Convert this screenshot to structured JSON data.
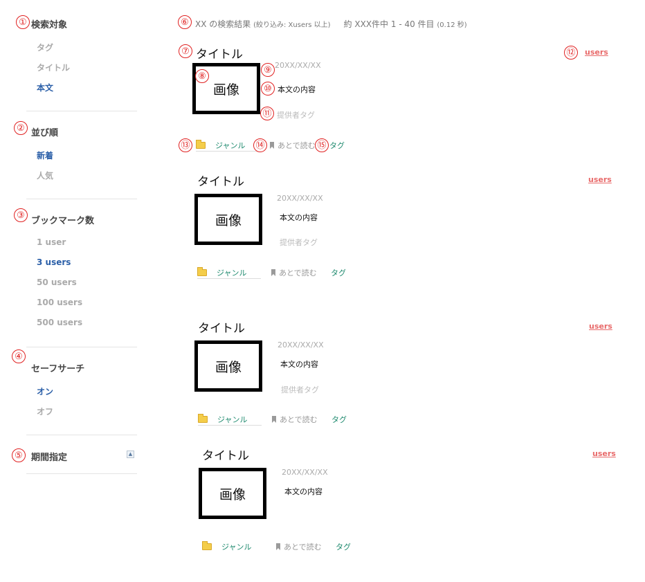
{
  "sidebar": {
    "sections": [
      {
        "heading": "検索対象",
        "items": [
          {
            "label": "タグ"
          },
          {
            "label": "タイトル"
          },
          {
            "label": "本文"
          }
        ]
      },
      {
        "heading": "並び順",
        "items": [
          {
            "label": "新着"
          },
          {
            "label": "人気"
          }
        ]
      },
      {
        "heading": "ブックマーク数",
        "items": [
          {
            "label": "1 user"
          },
          {
            "label": "3 users"
          },
          {
            "label": "50 users"
          },
          {
            "label": "100 users"
          },
          {
            "label": "500 users"
          }
        ]
      },
      {
        "heading": "セーフサーチ",
        "items": [
          {
            "label": "オン"
          },
          {
            "label": "オフ"
          }
        ]
      },
      {
        "heading": "期間指定"
      }
    ],
    "active_labels": [
      "本文",
      "新着",
      "3 users",
      "オン"
    ]
  },
  "results_header": {
    "query": "XX の検索結果",
    "filter": "(絞り込み: Xusers 以上)",
    "count": "約 XXX件中 1 - 40 件目",
    "time": "(0.12 秒)"
  },
  "entries": [
    {
      "title": "タイトル",
      "users": "users",
      "image": "画像",
      "date": "20XX/XX/XX",
      "body": "本文の内容",
      "provider_tag": "提供者タグ",
      "genre": "ジャンル",
      "read_later": "あとで読む",
      "tag": "タグ"
    },
    {
      "title": "タイトル",
      "users": "users",
      "image": "画像",
      "date": "20XX/XX/XX",
      "body": "本文の内容",
      "provider_tag": "提供者タグ",
      "genre": "ジャンル",
      "read_later": "あとで読む",
      "tag": "タグ"
    },
    {
      "title": "タイトル",
      "users": "users",
      "image": "画像",
      "date": "20XX/XX/XX",
      "body": "本文の内容",
      "provider_tag": "提供者タグ",
      "genre": "ジャンル",
      "read_later": "あとで読む",
      "tag": "タグ"
    },
    {
      "title": "タイトル",
      "users": "users",
      "image": "画像",
      "date": "20XX/XX/XX",
      "body": "本文の内容",
      "genre": "ジャンル",
      "read_later": "あとで読む",
      "tag": "タグ"
    }
  ],
  "annotations": [
    "①",
    "②",
    "③",
    "④",
    "⑤",
    "⑥",
    "⑦",
    "⑧",
    "⑨",
    "⑩",
    "⑪",
    "⑫",
    "⑬",
    "⑭",
    "⑮"
  ],
  "colors": {
    "active_link": "#2b5fa8",
    "users_link": "#e86a6a",
    "genre_tag": "#1e8a6e",
    "annotation": "#e02020"
  }
}
